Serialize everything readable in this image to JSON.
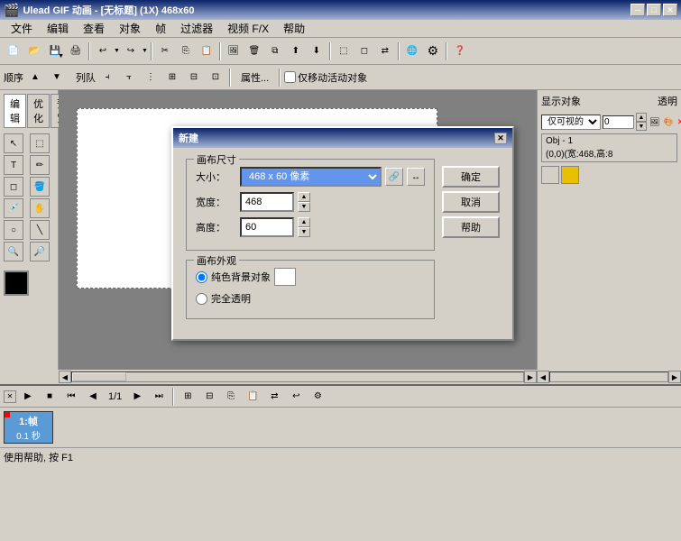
{
  "title": {
    "text": "Ulead GIF 动画 - [无标题] (1X) 468x60",
    "min_btn": "─",
    "max_btn": "□",
    "close_btn": "✕"
  },
  "menu": {
    "items": [
      "文件",
      "编辑",
      "查看",
      "对象",
      "帧",
      "过滤器",
      "视频 F/X",
      "帮助"
    ]
  },
  "toolbar2": {
    "labels": [
      "顺序",
      "列队"
    ],
    "props_btn": "属性...",
    "checkbox_label": "仅移动活动对象"
  },
  "tabs": {
    "items": [
      "编辑",
      "优化",
      "预览"
    ]
  },
  "right_panel": {
    "show_object_label": "显示对象",
    "transparency_label": "透明",
    "dropdown_value": "仅可视的",
    "num_value": "0",
    "obj_info": "Obj - 1",
    "obj_coords": "(0,0)(宽:468,高:8"
  },
  "dialog": {
    "title": "新建",
    "close_btn": "✕",
    "canvas_size_label": "画布尺寸",
    "size_label": "大小：",
    "size_value": "468 x 60 像素",
    "width_label": "宽度：",
    "width_value": "468",
    "height_label": "高度：",
    "height_value": "60",
    "canvas_appearance_label": "画布外观",
    "radio1_label": "纯色背景对象",
    "radio2_label": "完全透明",
    "ok_btn": "确定",
    "cancel_btn": "取消",
    "help_btn": "帮助"
  },
  "timeline": {
    "frame_label": "1:帧",
    "frame_time": "0.1 秒",
    "page_info": "1/1"
  },
  "status": {
    "text": "使用帮助, 按 F1"
  },
  "icons": {
    "arrow": "↖",
    "text": "T",
    "paint": "🖊",
    "eraser": "◻",
    "select": "⬚",
    "zoom_in": "🔍",
    "zoom_out": "🔎",
    "new": "📄",
    "open": "📂",
    "save": "💾",
    "cut": "✂",
    "copy": "⎘",
    "paste": "📋",
    "undo": "↩",
    "redo": "↪",
    "play": "▶",
    "stop": "■",
    "prev": "◀◀",
    "next": "▶▶",
    "first": "⏮",
    "last": "⏭"
  }
}
